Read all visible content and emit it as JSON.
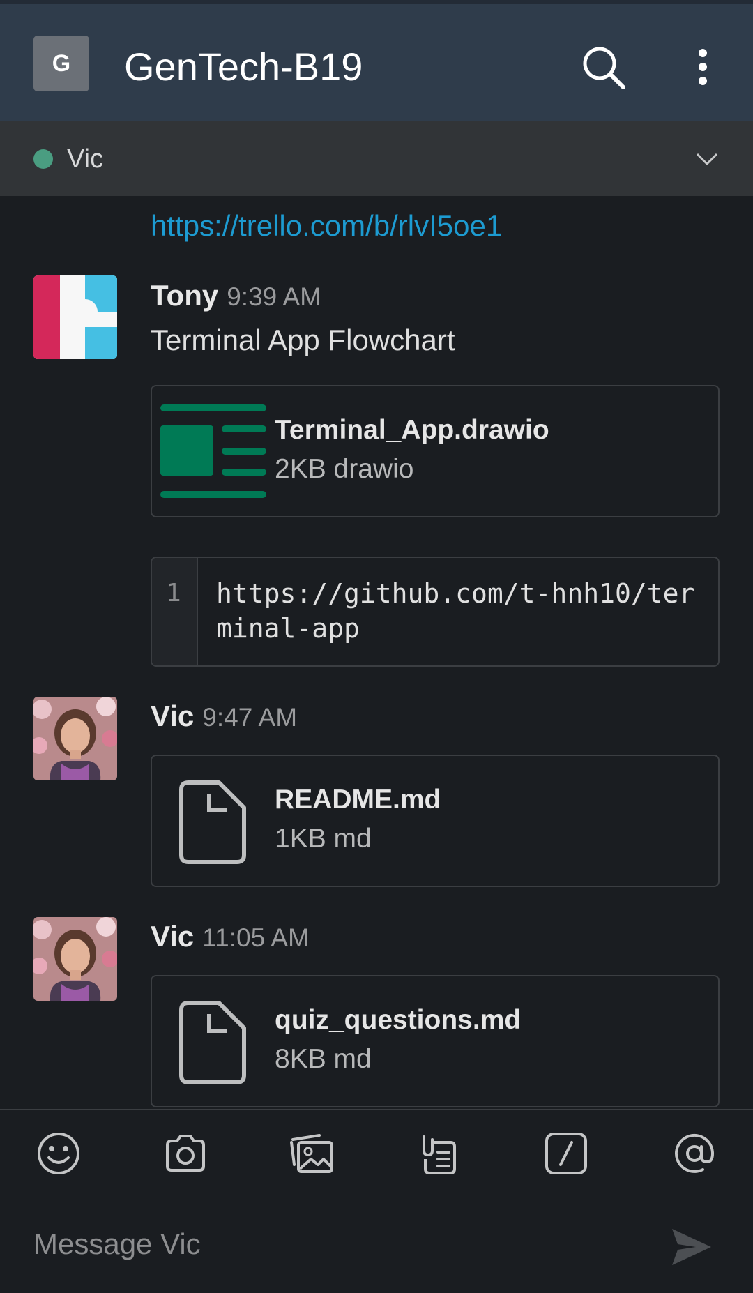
{
  "header": {
    "workspace_initial": "G",
    "title": "GenTech-B19",
    "search_icon": "search-icon",
    "more_icon": "more-vertical-icon"
  },
  "dm_bar": {
    "name": "Vic",
    "status_color": "#4a9d81",
    "chevron_icon": "chevron-down-icon"
  },
  "messages": {
    "prev_link": "https://trello.com/b/rlvI5oe1",
    "tony": {
      "author": "Tony",
      "time": "9:39 AM",
      "text": "Terminal App Flowchart",
      "file": {
        "name": "Terminal_App.drawio",
        "meta": "2KB drawio",
        "icon": "drawio-file-icon"
      },
      "code": {
        "line_number": "1",
        "text": "https://github.com/t-hnh10/terminal-app"
      }
    },
    "vic1": {
      "author": "Vic",
      "time": "9:47 AM",
      "file": {
        "name": "README.md",
        "meta": "1KB md",
        "icon": "document-icon"
      }
    },
    "vic2": {
      "author": "Vic",
      "time": "11:05 AM",
      "file": {
        "name": "quiz_questions.md",
        "meta": "8KB md",
        "icon": "document-icon"
      }
    }
  },
  "composer": {
    "placeholder": "Message Vic",
    "tools": [
      "emoji-icon",
      "camera-icon",
      "photo-icon",
      "files-icon",
      "slash-command-icon",
      "mention-icon"
    ],
    "send_icon": "send-icon"
  },
  "colors": {
    "link": "#1d9bd1",
    "header_bg": "#2f3c4b",
    "drawio_green": "#007a55"
  }
}
